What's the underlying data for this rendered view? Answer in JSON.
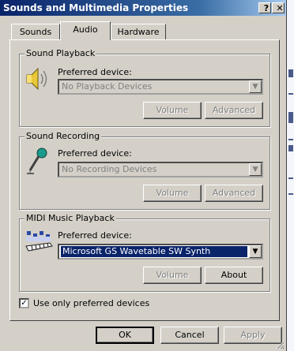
{
  "window": {
    "title": "Sounds and Multimedia Properties",
    "help_glyph": "?",
    "close_glyph": "✕"
  },
  "tabs": [
    {
      "label": "Sounds",
      "active": false
    },
    {
      "label": "Audio",
      "active": true
    },
    {
      "label": "Hardware",
      "active": false
    }
  ],
  "playback": {
    "group_label": "Sound Playback",
    "preferred_label": "Preferred device:",
    "device_value": "No Playback Devices",
    "enabled": false,
    "volume_label": "Volume",
    "advanced_label": "Advanced",
    "icon": "speaker-icon"
  },
  "recording": {
    "group_label": "Sound Recording",
    "preferred_label": "Preferred device:",
    "device_value": "No Recording Devices",
    "enabled": false,
    "volume_label": "Volume",
    "advanced_label": "Advanced",
    "icon": "microphone-icon"
  },
  "midi": {
    "group_label": "MIDI Music Playback",
    "preferred_label": "Preferred device:",
    "device_value": "Microsoft GS Wavetable SW Synth",
    "enabled": true,
    "volume_label": "Volume",
    "about_label": "About",
    "icon": "midi-keyboard-icon"
  },
  "use_preferred": {
    "label": "Use only preferred devices",
    "checked": true,
    "check_glyph": "✓"
  },
  "footer": {
    "ok_label": "OK",
    "cancel_label": "Cancel",
    "apply_label": "Apply"
  },
  "colors": {
    "title_start": "#0a246a",
    "title_end": "#a6caf0",
    "face": "#d4d0c8",
    "selection": "#0a246a"
  }
}
